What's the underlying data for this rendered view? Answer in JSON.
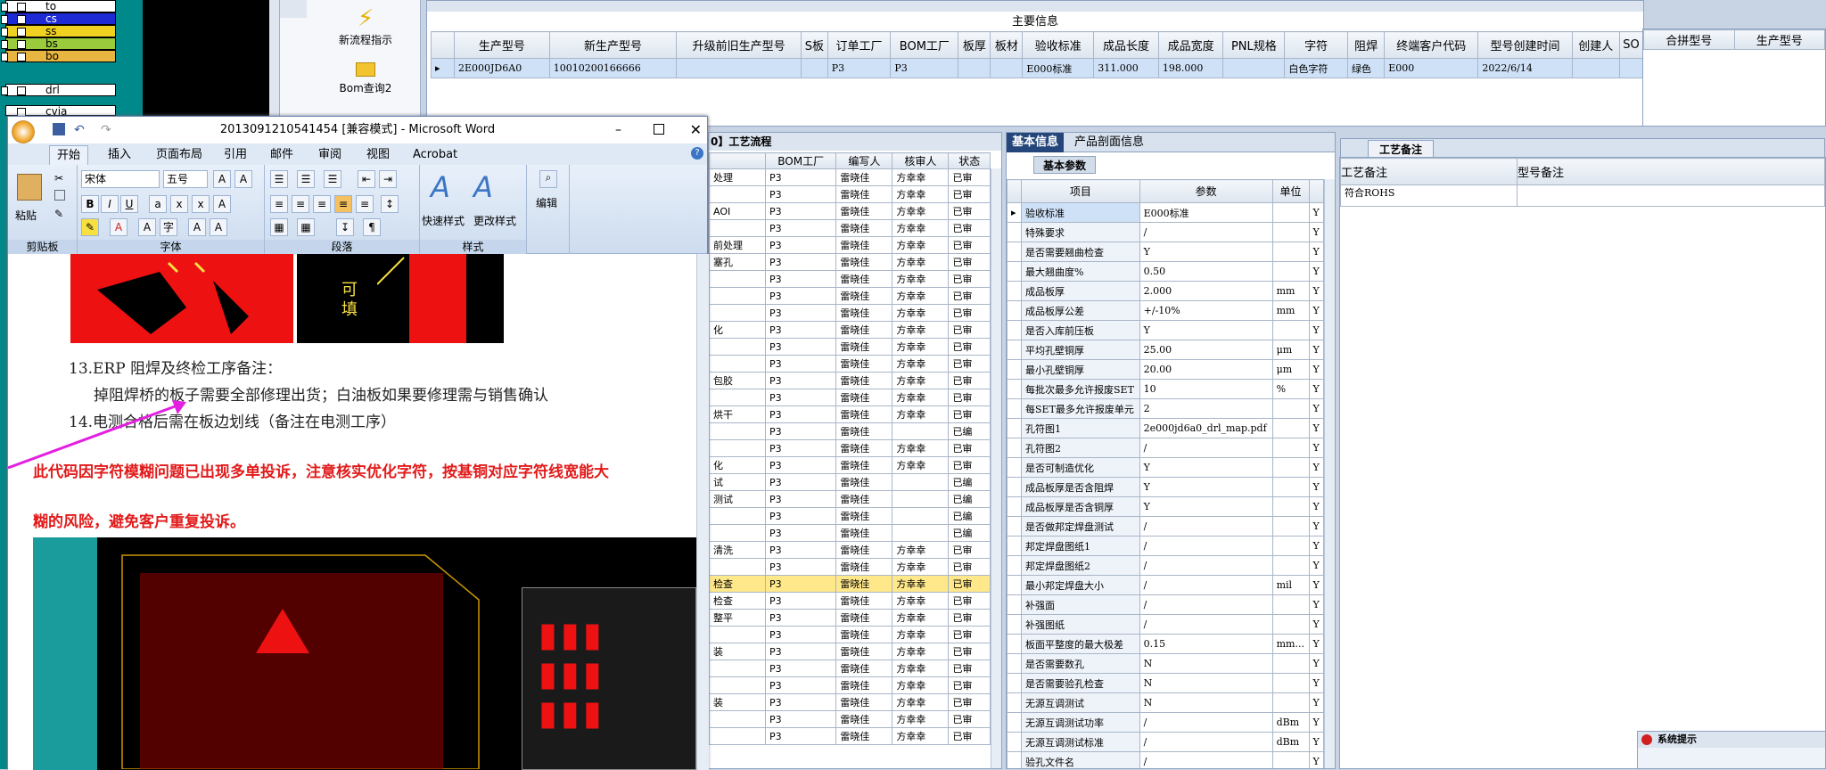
{
  "layers": {
    "items": [
      "to",
      "cs",
      "ss",
      "bs",
      "bo",
      "drl",
      "cvia"
    ]
  },
  "nav": {
    "new_flow_label": "新流程指示",
    "bom_query_label": "Bom查询2"
  },
  "main_info": {
    "title": "主要信息",
    "columns": [
      "生产型号",
      "新生产型号",
      "升级前旧生产型号",
      "S板",
      "订单工厂",
      "BOM工厂",
      "板厚",
      "板材",
      "验收标准",
      "成品长度",
      "成品宽度",
      "PNL规格",
      "字符",
      "阻焊",
      "终端客户代码",
      "型号创建时间",
      "创建人",
      "SO"
    ],
    "row": [
      "2E000JD6A0",
      "10010200166666",
      "",
      "",
      "P3",
      "P3",
      "",
      "",
      "E000标准",
      "311.000",
      "198.000",
      "",
      "白色字符",
      "绿色",
      "E000",
      "2022/6/14",
      "",
      ""
    ]
  },
  "right_header": {
    "columns": [
      "合拼型号",
      "生产型号"
    ]
  },
  "word": {
    "title": "2013091210541454 [兼容模式] - Microsoft Word",
    "tabs": [
      "开始",
      "插入",
      "页面布局",
      "引用",
      "邮件",
      "审阅",
      "视图",
      "Acrobat"
    ],
    "groups": [
      "剪贴板",
      "字体",
      "段落",
      "样式",
      "编辑"
    ],
    "paste_label": "粘贴",
    "font_name": "宋体",
    "font_size": "五号",
    "quick_style_label": "快速样式",
    "change_style_label": "更改样式",
    "edit_label": "编辑",
    "img_text": "可\n填",
    "doc_lines": [
      "13.ERP 阻焊及终检工序备注：",
      "掉阻焊桥的板子需要全部修理出货；白油板如果要修理需与销售确认",
      "14.电测合格后需在板边划线（备注在电测工序）"
    ],
    "red_lines": [
      "此代码因字符模糊问题已出现多单投诉，注意核实优化字符，按基铜对应字符线宽能大",
      "糊的风险，避免客户重复投诉。"
    ]
  },
  "flow": {
    "title": "0】工艺流程",
    "columns": [
      "",
      "BOM工厂",
      "编写人",
      "核审人",
      "状态"
    ],
    "rows": [
      [
        "处理",
        "P3",
        "雷晓佳",
        "方幸幸",
        "已审"
      ],
      [
        "",
        "P3",
        "雷晓佳",
        "方幸幸",
        "已审"
      ],
      [
        "AOI",
        "P3",
        "雷晓佳",
        "方幸幸",
        "已审"
      ],
      [
        "",
        "P3",
        "雷晓佳",
        "方幸幸",
        "已审"
      ],
      [
        "前处理",
        "P3",
        "雷晓佳",
        "方幸幸",
        "已审"
      ],
      [
        "塞孔",
        "P3",
        "雷晓佳",
        "方幸幸",
        "已审"
      ],
      [
        "",
        "P3",
        "雷晓佳",
        "方幸幸",
        "已审"
      ],
      [
        "",
        "P3",
        "雷晓佳",
        "方幸幸",
        "已审"
      ],
      [
        "",
        "P3",
        "雷晓佳",
        "方幸幸",
        "已审"
      ],
      [
        "化",
        "P3",
        "雷晓佳",
        "方幸幸",
        "已审"
      ],
      [
        "",
        "P3",
        "雷晓佳",
        "方幸幸",
        "已审"
      ],
      [
        "",
        "P3",
        "雷晓佳",
        "方幸幸",
        "已审"
      ],
      [
        "包胶",
        "P3",
        "雷晓佳",
        "方幸幸",
        "已审"
      ],
      [
        "",
        "P3",
        "雷晓佳",
        "方幸幸",
        "已审"
      ],
      [
        "烘干",
        "P3",
        "雷晓佳",
        "方幸幸",
        "已审"
      ],
      [
        "",
        "P3",
        "雷晓佳",
        "",
        "已编"
      ],
      [
        "",
        "P3",
        "雷晓佳",
        "方幸幸",
        "已审"
      ],
      [
        "化",
        "P3",
        "雷晓佳",
        "方幸幸",
        "已审"
      ],
      [
        "试",
        "P3",
        "雷晓佳",
        "",
        "已编"
      ],
      [
        "测试",
        "P3",
        "雷晓佳",
        "",
        "已编"
      ],
      [
        "",
        "P3",
        "雷晓佳",
        "",
        "已编"
      ],
      [
        "",
        "P3",
        "雷晓佳",
        "",
        "已编"
      ],
      [
        "清洗",
        "P3",
        "雷晓佳",
        "方幸幸",
        "已审"
      ],
      [
        "",
        "P3",
        "雷晓佳",
        "方幸幸",
        "已审"
      ],
      [
        "检查",
        "P3",
        "雷晓佳",
        "方幸幸",
        "已审"
      ],
      [
        "检查",
        "P3",
        "雷晓佳",
        "方幸幸",
        "已审"
      ],
      [
        "整平",
        "P3",
        "雷晓佳",
        "方幸幸",
        "已审"
      ],
      [
        "",
        "P3",
        "雷晓佳",
        "方幸幸",
        "已审"
      ],
      [
        "装",
        "P3",
        "雷晓佳",
        "方幸幸",
        "已审"
      ],
      [
        "",
        "P3",
        "雷晓佳",
        "方幸幸",
        "已审"
      ],
      [
        "",
        "P3",
        "雷晓佳",
        "方幸幸",
        "已审"
      ],
      [
        "装",
        "P3",
        "雷晓佳",
        "方幸幸",
        "已审"
      ],
      [
        "",
        "P3",
        "雷晓佳",
        "方幸幸",
        "已审"
      ],
      [
        "",
        "P3",
        "雷晓佳",
        "方幸幸",
        "已审"
      ]
    ],
    "highlight_index": 24
  },
  "basic": {
    "tab_basic": "基本信息",
    "tab_profile": "产品剖面信息",
    "subtab": "基本参数",
    "columns": [
      "项目",
      "参数",
      "单位",
      ""
    ],
    "rows": [
      [
        "验收标准",
        "E000标准",
        "",
        "Y"
      ],
      [
        "特殊要求",
        "/",
        "",
        "Y"
      ],
      [
        "是否需要翘曲检查",
        "Y",
        "",
        "Y"
      ],
      [
        "最大翘曲度%",
        "0.50",
        "",
        "Y"
      ],
      [
        "成品板厚",
        "2.000",
        "mm",
        "Y"
      ],
      [
        "成品板厚公差",
        "+/-10%",
        "mm",
        "Y"
      ],
      [
        "是否入库前压板",
        "Y",
        "",
        "Y"
      ],
      [
        "平均孔壁铜厚",
        "25.00",
        "μm",
        "Y"
      ],
      [
        "最小孔壁铜厚",
        "20.00",
        "μm",
        "Y"
      ],
      [
        "每批次最多允许报废SET",
        "10",
        "%",
        "Y"
      ],
      [
        "每SET最多允许报废单元",
        "2",
        "",
        "Y"
      ],
      [
        "孔符图1",
        "2e000jd6a0_drl_map.pdf",
        "",
        "Y"
      ],
      [
        "孔符图2",
        "/",
        "",
        "Y"
      ],
      [
        "是否可制造优化",
        "Y",
        "",
        "Y"
      ],
      [
        "成品板厚是否含阻焊",
        "Y",
        "",
        "Y"
      ],
      [
        "成品板厚是否含铜厚",
        "Y",
        "",
        "Y"
      ],
      [
        "是否做邦定焊盘测试",
        "/",
        "",
        "Y"
      ],
      [
        "邦定焊盘图纸1",
        "/",
        "",
        "Y"
      ],
      [
        "邦定焊盘图纸2",
        "/",
        "",
        "Y"
      ],
      [
        "最小邦定焊盘大小",
        "/",
        "mil",
        "Y"
      ],
      [
        "补强面",
        "/",
        "",
        "Y"
      ],
      [
        "补强图纸",
        "/",
        "",
        "Y"
      ],
      [
        "板面平整度的最大极差",
        "0.15",
        "mm...",
        "Y"
      ],
      [
        "是否需要数孔",
        "N",
        "",
        "Y"
      ],
      [
        "是否需要验孔检查",
        "N",
        "",
        "Y"
      ],
      [
        "无源互调测试",
        "N",
        "",
        "Y"
      ],
      [
        "无源互调测试功率",
        "/",
        "dBm",
        "Y"
      ],
      [
        "无源互调测试标准",
        "/",
        "dBm",
        "Y"
      ],
      [
        "验孔文件名",
        "/",
        "",
        "Y"
      ]
    ]
  },
  "remarks": {
    "tab": "工艺备注",
    "col1": "工艺备注",
    "col2": "型号备注",
    "value": "符合ROHS"
  },
  "sysbox": {
    "title": "系统提示"
  },
  "colors": {
    "layer_cs": "#1e2bd4",
    "layer_ss": "#9acb3c",
    "layer_bs": "#e8b540",
    "highlight_row": "#ffe88a",
    "red_text": "#e21b1b",
    "arrow": "#e31fe0"
  }
}
